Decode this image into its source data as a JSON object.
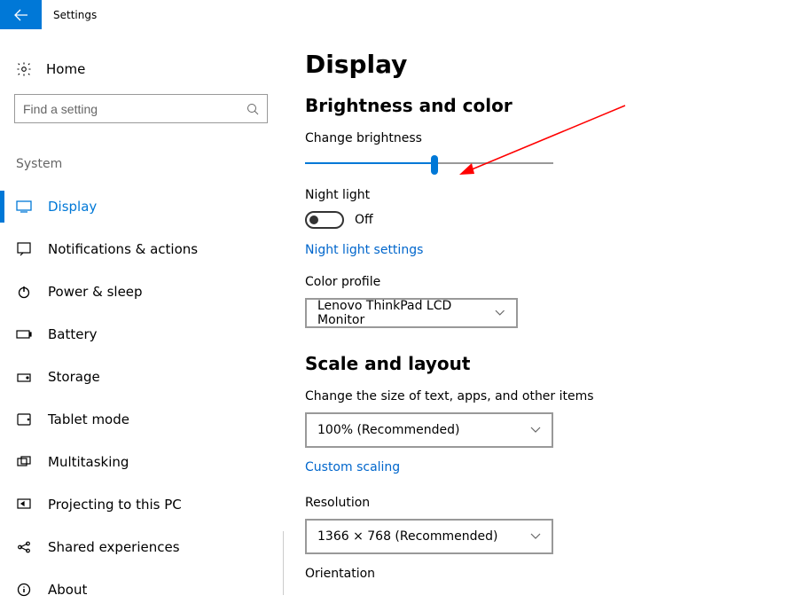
{
  "header": {
    "title": "Settings"
  },
  "sidebar": {
    "home_label": "Home",
    "search_placeholder": "Find a setting",
    "category": "System",
    "items": [
      {
        "label": "Display",
        "icon": "display-icon",
        "active": true
      },
      {
        "label": "Notifications & actions",
        "icon": "notifications-icon",
        "active": false
      },
      {
        "label": "Power & sleep",
        "icon": "power-icon",
        "active": false
      },
      {
        "label": "Battery",
        "icon": "battery-icon",
        "active": false
      },
      {
        "label": "Storage",
        "icon": "storage-icon",
        "active": false
      },
      {
        "label": "Tablet mode",
        "icon": "tablet-icon",
        "active": false
      },
      {
        "label": "Multitasking",
        "icon": "multitasking-icon",
        "active": false
      },
      {
        "label": "Projecting to this PC",
        "icon": "projecting-icon",
        "active": false
      },
      {
        "label": "Shared experiences",
        "icon": "share-icon",
        "active": false
      },
      {
        "label": "About",
        "icon": "about-icon",
        "active": false
      }
    ]
  },
  "content": {
    "page_title": "Display",
    "section1_title": "Brightness and color",
    "brightness_label": "Change brightness",
    "brightness_percent": 52,
    "night_light_label": "Night light",
    "night_light_state": "Off",
    "night_light_link": "Night light settings",
    "color_profile_label": "Color profile",
    "color_profile_value": "Lenovo ThinkPad LCD Monitor",
    "section2_title": "Scale and layout",
    "scale_label": "Change the size of text, apps, and other items",
    "scale_value": "100% (Recommended)",
    "custom_scaling_link": "Custom scaling",
    "resolution_label": "Resolution",
    "resolution_value": "1366 × 768 (Recommended)",
    "orientation_label": "Orientation"
  },
  "colors": {
    "accent": "#0078d7",
    "link": "#0066cc"
  }
}
